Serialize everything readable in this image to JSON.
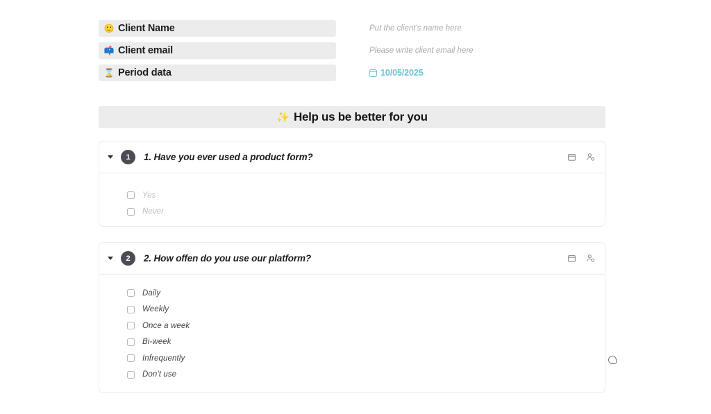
{
  "meta": {
    "rows": [
      {
        "icon": "person-face-icon",
        "glyph": "🙂",
        "label": "Client Name",
        "value": "Put the client's name here",
        "value_kind": "placeholder"
      },
      {
        "icon": "mailbox-icon",
        "glyph": "📫",
        "label": "Client email",
        "value": "Please write client email here",
        "value_kind": "placeholder"
      },
      {
        "icon": "hourglass-icon",
        "glyph": "⌛",
        "label": "Period data",
        "value": "10/05/2025",
        "value_kind": "date"
      }
    ]
  },
  "banner": {
    "sparkle": "✨",
    "title": "Help us be better for you"
  },
  "cards": [
    {
      "number": "1",
      "question": "1. Have you ever used a product form?",
      "option_style": "muted",
      "options": [
        "Yes",
        "Never"
      ],
      "actions": [
        {
          "icon": "calendar-icon",
          "name": "date-property-icon"
        },
        {
          "icon": "person-settings-icon",
          "name": "assignee-property-icon"
        }
      ]
    },
    {
      "number": "2",
      "question": "2. How offen do you use our platform?",
      "option_style": "dark",
      "options": [
        "Daily",
        "Weekly",
        "Once a week",
        "Bi-week",
        "Infrequently",
        "Don't use"
      ],
      "actions": [
        {
          "icon": "calendar-icon",
          "name": "date-property-icon"
        },
        {
          "icon": "person-settings-icon",
          "name": "assignee-property-icon"
        }
      ]
    }
  ],
  "colors": {
    "field_background": "#ECECEC",
    "badge_background": "#4C4C54",
    "date_accent": "#6CC2D4",
    "text_primary": "#1B1B1F",
    "text_muted": "#BDBDC1",
    "text_option": "#44444A",
    "card_border": "#ECECEC"
  }
}
